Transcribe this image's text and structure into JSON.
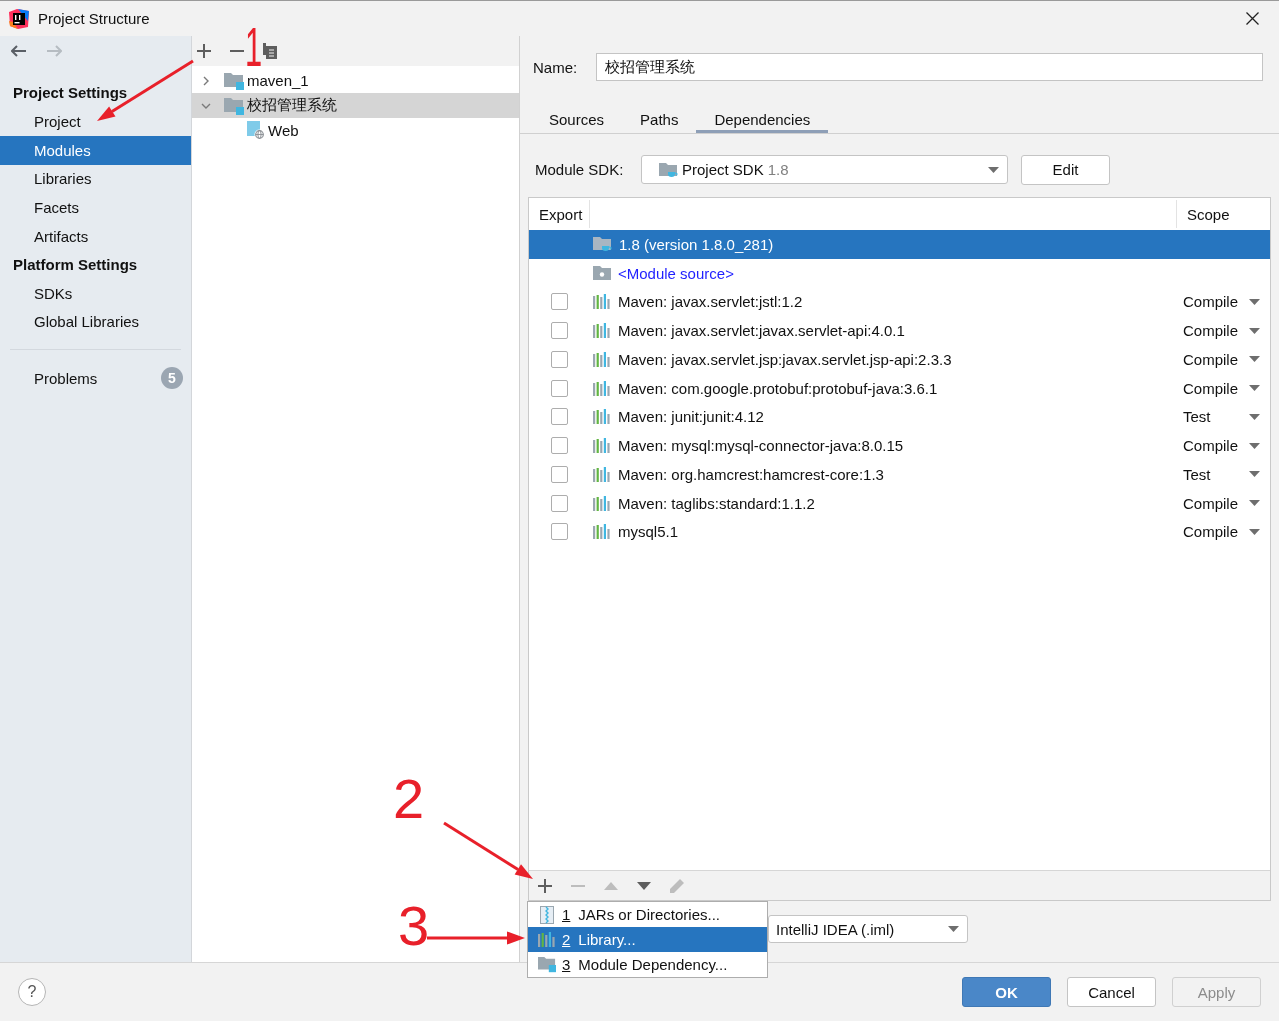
{
  "window": {
    "title": "Project Structure"
  },
  "sidebar": {
    "nav": [
      {
        "kind": "back",
        "disabled": false
      },
      {
        "kind": "forward",
        "disabled": true
      }
    ],
    "sections": [
      {
        "heading": "Project Settings",
        "items": [
          {
            "label": "Project",
            "selected": false
          },
          {
            "label": "Modules",
            "selected": true
          },
          {
            "label": "Libraries",
            "selected": false
          },
          {
            "label": "Facets",
            "selected": false
          },
          {
            "label": "Artifacts",
            "selected": false
          }
        ]
      },
      {
        "heading": "Platform Settings",
        "items": [
          {
            "label": "SDKs",
            "selected": false
          },
          {
            "label": "Global Libraries",
            "selected": false
          }
        ]
      }
    ],
    "problems": {
      "label": "Problems",
      "badge": "5",
      "selected": false
    }
  },
  "module_tree": {
    "toolbar": [
      {
        "kind": "add",
        "disabled": false
      },
      {
        "kind": "remove",
        "disabled": false
      },
      {
        "kind": "copy",
        "disabled": false
      }
    ],
    "items": [
      {
        "label": "maven_1",
        "kind": "module",
        "expanded": false,
        "selected": false
      },
      {
        "label": "校招管理系统",
        "kind": "module",
        "expanded": true,
        "selected": true,
        "children": [
          {
            "label": "Web",
            "kind": "web",
            "selected": false
          }
        ]
      }
    ]
  },
  "module_editor": {
    "name": {
      "label": "Name:",
      "value": "校招管理系统"
    },
    "tabs": [
      {
        "label": "Sources",
        "selected": false
      },
      {
        "label": "Paths",
        "selected": false
      },
      {
        "label": "Dependencies",
        "selected": true
      }
    ],
    "sdk": {
      "label": "Module SDK:",
      "value": "Project SDK",
      "version": "1.8",
      "button": "Edit"
    },
    "dependencies": {
      "columns": {
        "export": "Export",
        "scope": "Scope"
      },
      "rows": [
        {
          "kind": "sdk",
          "name": "1.8 (version 1.8.0_281)",
          "selected": true
        },
        {
          "kind": "source",
          "name": "<Module source>",
          "selected": false
        },
        {
          "kind": "library",
          "name": "Maven: javax.servlet:jstl:1.2",
          "exported": false,
          "scope": "Compile",
          "selected": false
        },
        {
          "kind": "library",
          "name": "Maven: javax.servlet:javax.servlet-api:4.0.1",
          "exported": false,
          "scope": "Compile",
          "selected": false
        },
        {
          "kind": "library",
          "name": "Maven: javax.servlet.jsp:javax.servlet.jsp-api:2.3.3",
          "exported": false,
          "scope": "Compile",
          "selected": false
        },
        {
          "kind": "library",
          "name": "Maven: com.google.protobuf:protobuf-java:3.6.1",
          "exported": false,
          "scope": "Compile",
          "selected": false
        },
        {
          "kind": "library",
          "name": "Maven: junit:junit:4.12",
          "exported": false,
          "scope": "Test",
          "selected": false
        },
        {
          "kind": "library",
          "name": "Maven: mysql:mysql-connector-java:8.0.15",
          "exported": false,
          "scope": "Compile",
          "selected": false
        },
        {
          "kind": "library",
          "name": "Maven: org.hamcrest:hamcrest-core:1.3",
          "exported": false,
          "scope": "Test",
          "selected": false
        },
        {
          "kind": "library",
          "name": "Maven: taglibs:standard:1.1.2",
          "exported": false,
          "scope": "Compile",
          "selected": false
        },
        {
          "kind": "library",
          "name": "mysql5.1",
          "exported": false,
          "scope": "Compile",
          "selected": false
        }
      ]
    },
    "toolbar": [
      {
        "kind": "add",
        "disabled": false
      },
      {
        "kind": "remove",
        "disabled": true
      },
      {
        "kind": "move_up",
        "disabled": true
      },
      {
        "kind": "move_down",
        "disabled": false
      },
      {
        "kind": "edit",
        "disabled": true
      }
    ],
    "add_menu": [
      {
        "key": "1",
        "label": "JARs or Directories...",
        "kind": "jars",
        "selected": false
      },
      {
        "key": "2",
        "label": "Library...",
        "kind": "library",
        "selected": true
      },
      {
        "key": "3",
        "label": "Module Dependency...",
        "kind": "module",
        "selected": false
      }
    ],
    "storage_format": {
      "value": "IntelliJ IDEA (.iml)"
    }
  },
  "footer": {
    "help": "?",
    "buttons": [
      {
        "label": "OK",
        "kind": "primary",
        "disabled": false
      },
      {
        "label": "Cancel",
        "kind": "normal",
        "disabled": false
      },
      {
        "label": "Apply",
        "kind": "normal",
        "disabled": true
      }
    ]
  },
  "annotations": [
    {
      "label": "1"
    },
    {
      "label": "2"
    },
    {
      "label": "3"
    }
  ]
}
